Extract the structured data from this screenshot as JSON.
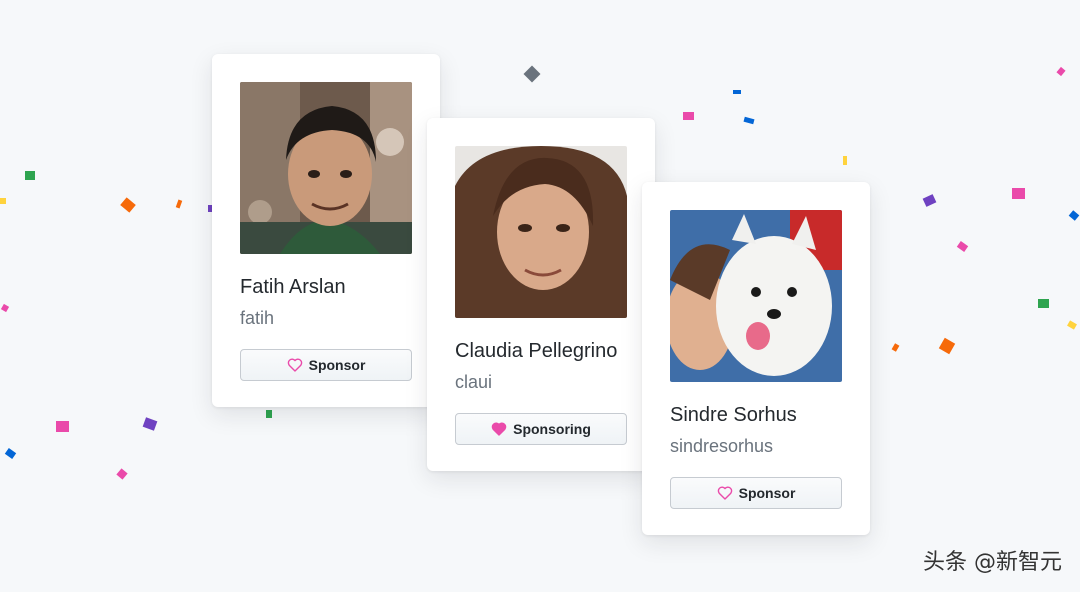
{
  "colors": {
    "background": "#f6f8fa",
    "sponsor_heart": "#ea4aaa",
    "confetti": [
      "#2ea44f",
      "#f66a0a",
      "#6f42c1",
      "#ea4aaa",
      "#0366d6",
      "#ffd33d",
      "#6a737d"
    ]
  },
  "cards": [
    {
      "name": "Fatih Arslan",
      "login": "fatih",
      "button_label": "Sponsor",
      "button_icon": "heart-outline-icon",
      "sponsoring": false
    },
    {
      "name": "Claudia Pellegrino",
      "login": "claui",
      "button_label": "Sponsoring",
      "button_icon": "heart-filled-icon",
      "sponsoring": true
    },
    {
      "name": "Sindre Sorhus",
      "login": "sindresorhus",
      "button_label": "Sponsor",
      "button_icon": "heart-outline-icon",
      "sponsoring": false
    }
  ],
  "watermark": "头条 @新智元"
}
